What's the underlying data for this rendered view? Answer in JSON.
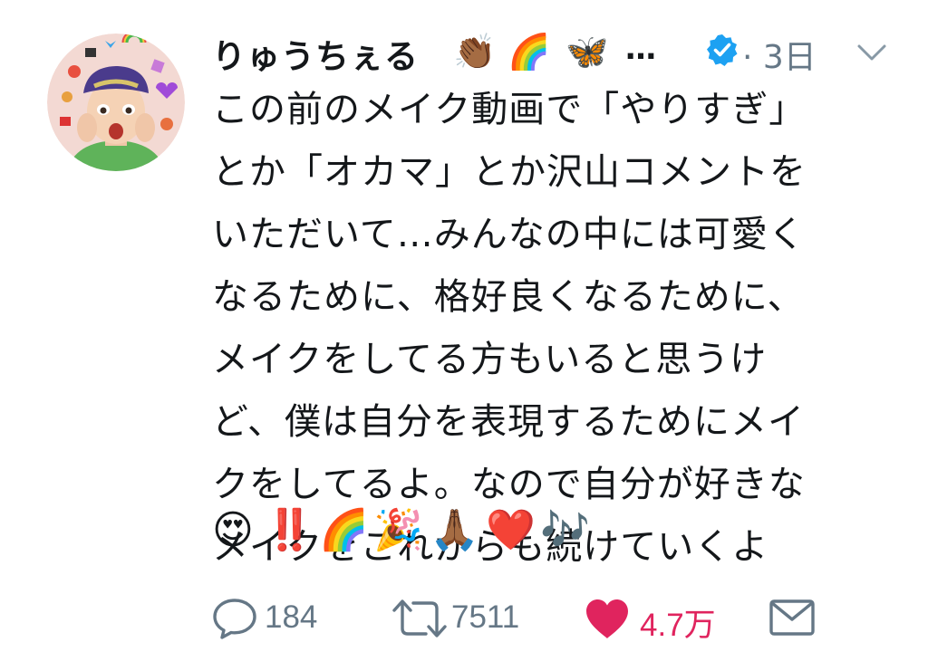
{
  "tweet": {
    "display_name": "りゅうちぇる",
    "name_emojis": [
      "👏🏾",
      "🌈",
      "🦋"
    ],
    "name_ellipsis": "…",
    "verified": true,
    "separator": "·",
    "time": "3日",
    "caret_icon": "chevron-down-icon",
    "body_lines": [
      "この前のメイク動画で「やりすぎ」",
      "とか「オカマ」とか沢山コメントを",
      "いただいて…みんなの中には可愛く",
      "なるために、格好良くなるために、",
      "メイクをしてる方もいると思うけ",
      "ど、僕は自分を表現するためにメイ",
      "クをしてるよ。なので自分が好きな",
      "メイクをこれからも続けていくよ"
    ],
    "emoji_line": [
      "😍",
      "‼️",
      "🌈",
      "🎉",
      "🙏🏾",
      "❤️",
      "🎶"
    ],
    "actions": {
      "reply": {
        "icon": "reply-icon",
        "count": "184"
      },
      "retweet": {
        "icon": "retweet-icon",
        "count": "7511"
      },
      "like": {
        "icon": "heart-icon",
        "count": "4.7万",
        "active": true
      },
      "dm": {
        "icon": "envelope-icon"
      }
    },
    "colors": {
      "text": "#14171a",
      "muted": "#657786",
      "like": "#e0245e",
      "verified": "#1da1f2"
    }
  }
}
